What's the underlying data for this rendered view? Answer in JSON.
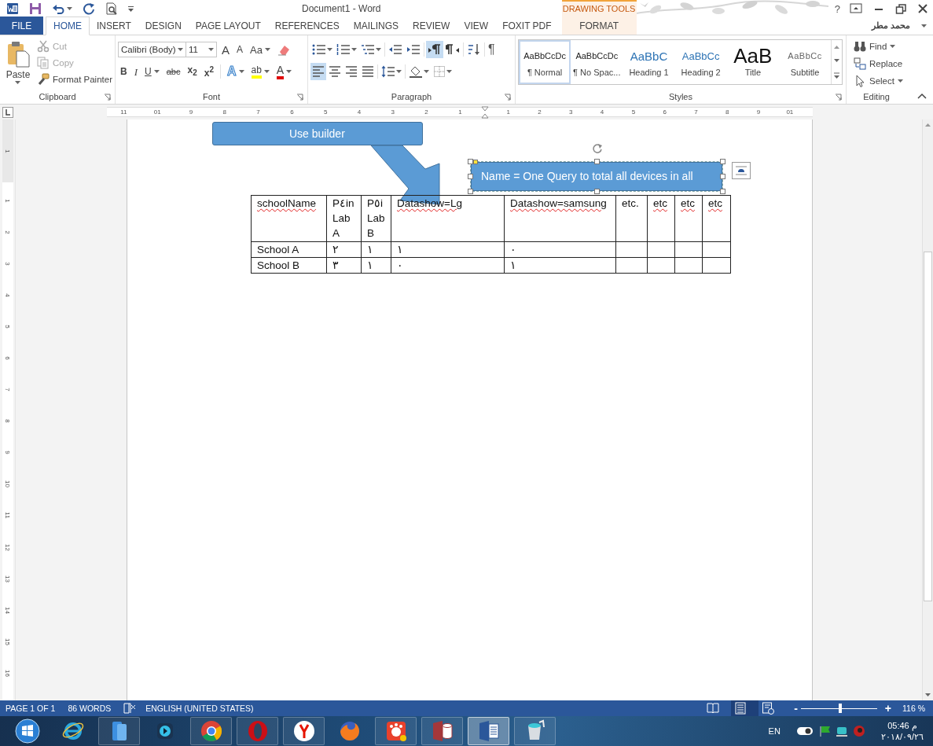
{
  "title_bar": {
    "title": "Document1 - Word",
    "help": "?"
  },
  "tabs": [
    {
      "label": "FILE",
      "kind": "file",
      "selected": false
    },
    {
      "label": "HOME",
      "kind": "normal",
      "selected": true
    },
    {
      "label": "INSERT",
      "kind": "normal",
      "selected": false
    },
    {
      "label": "DESIGN",
      "kind": "normal",
      "selected": false
    },
    {
      "label": "PAGE LAYOUT",
      "kind": "normal",
      "selected": false
    },
    {
      "label": "REFERENCES",
      "kind": "normal",
      "selected": false
    },
    {
      "label": "MAILINGS",
      "kind": "normal",
      "selected": false
    },
    {
      "label": "REVIEW",
      "kind": "normal",
      "selected": false
    },
    {
      "label": "VIEW",
      "kind": "normal",
      "selected": false
    },
    {
      "label": "FOXIT PDF",
      "kind": "normal",
      "selected": false
    },
    {
      "label": "FORMAT",
      "kind": "contextual",
      "header": "DRAWING TOOLS",
      "selected": false
    }
  ],
  "account": {
    "name": "محمد مطر"
  },
  "clipboard": {
    "label": "Clipboard",
    "paste": "Paste",
    "items": [
      {
        "label": "Cut",
        "kind": "cut",
        "disabled": true
      },
      {
        "label": "Copy",
        "kind": "copy",
        "disabled": true
      },
      {
        "label": "Format Painter",
        "kind": "painter",
        "disabled": false
      }
    ]
  },
  "font": {
    "label": "Font",
    "font_name": "Calibri (Body)",
    "font_size": "11",
    "row1": [
      {
        "text": "A",
        "kind": "grow"
      },
      {
        "text": "A",
        "kind": "shrink"
      },
      {
        "text": "Aa",
        "kind": "case"
      },
      {
        "kind": "clear"
      }
    ],
    "row2": [
      {
        "text": "B",
        "kind": "bold"
      },
      {
        "text": "I",
        "kind": "italic"
      },
      {
        "text": "U",
        "kind": "underline"
      },
      {
        "text": "abc",
        "kind": "strike"
      },
      {
        "text": "x$_{2}$",
        "kind": "sub"
      },
      {
        "text": "x$^{2}$",
        "kind": "sup"
      },
      {
        "text": "A",
        "kind": "effects"
      },
      {
        "text": "ab",
        "kind": "highlight"
      },
      {
        "text": "A",
        "kind": "color"
      }
    ]
  },
  "paragraph": {
    "label": "Paragraph",
    "row1": [
      {
        "kind": "bullets",
        "selected": false
      },
      {
        "kind": "numbering",
        "selected": false
      },
      {
        "kind": "multilevel",
        "selected": false
      },
      {
        "kind": "outdent",
        "selected": false
      },
      {
        "kind": "indent",
        "selected": false
      },
      {
        "kind": "ltr",
        "selected": true
      },
      {
        "kind": "rtl",
        "selected": false
      },
      {
        "kind": "sort",
        "selected": false
      },
      {
        "kind": "pilcrow",
        "text": "¶",
        "selected": false
      }
    ],
    "row2": [
      {
        "kind": "align_left",
        "selected": true
      },
      {
        "kind": "align_center",
        "selected": false
      },
      {
        "kind": "align_right",
        "selected": false
      },
      {
        "kind": "justify",
        "selected": false
      },
      {
        "kind": "spacing",
        "selected": false
      },
      {
        "kind": "shading",
        "selected": false
      },
      {
        "kind": "borders",
        "selected": false
      }
    ]
  },
  "styles": {
    "label": "Styles",
    "items": [
      {
        "sample": "AaBbCcDc",
        "label": "¶ Normal",
        "kind": "normal",
        "selected": true
      },
      {
        "sample": "AaBbCcDc",
        "label": "¶ No Spac...",
        "kind": "normal",
        "selected": false
      },
      {
        "sample": "AaBbC",
        "label": "Heading 1",
        "kind": "heading1",
        "selected": false
      },
      {
        "sample": "AaBbCc",
        "label": "Heading 2",
        "kind": "heading2",
        "selected": false
      },
      {
        "sample": "AaB",
        "label": "Title",
        "kind": "title",
        "selected": false
      },
      {
        "sample": "AaBbCc",
        "label": "Subtitle",
        "kind": "subtitle",
        "selected": false
      }
    ]
  },
  "editing": {
    "label": "Editing",
    "items": [
      {
        "label": "Find",
        "kind": "find"
      },
      {
        "label": "Replace",
        "kind": "replace"
      },
      {
        "label": "Select",
        "kind": "select"
      }
    ]
  },
  "ruler": {
    "left_numbers": [
      "11",
      "01",
      "9",
      "8",
      "7",
      "6",
      "5",
      "4",
      "3",
      "2",
      "1"
    ],
    "right_numbers": [
      "1",
      "2",
      "3",
      "4",
      "5",
      "6",
      "7",
      "8",
      "9",
      "01"
    ]
  },
  "vertical_ruler": {
    "top_number": "1",
    "numbers": [
      "1",
      "2",
      "3",
      "4",
      "5",
      "6",
      "7",
      "8",
      "9",
      "10",
      "11",
      "12",
      "13",
      "14",
      "15",
      "16"
    ]
  },
  "document": {
    "callout": {
      "text": "Use builder"
    },
    "textbox": {
      "text": "Name = One Query to total all devices in all",
      "selected": true
    },
    "table": {
      "header": [
        {
          "text": "schoolName",
          "misspelled": true
        },
        {
          "text": "P٤in Lab A",
          "misspelled": false
        },
        {
          "text": "P٥i Lab B",
          "misspelled": false
        },
        {
          "text": "Datashow=Lg",
          "misspelled": true
        },
        {
          "text": "Datashow=samsung",
          "misspelled": true
        },
        {
          "text": "etc.",
          "misspelled": false
        },
        {
          "text": "etc",
          "misspelled": true
        },
        {
          "text": "etc",
          "misspelled": true
        },
        {
          "text": "etc",
          "misspelled": true
        }
      ],
      "rows": [
        {
          "cells": [
            "School A",
            "٢",
            "١",
            "١",
            "٠"
          ]
        },
        {
          "cells": [
            "School B",
            "٣",
            "١",
            "٠",
            "١"
          ]
        }
      ]
    }
  },
  "status_bar": {
    "page": "PAGE 1 OF 1",
    "words": "86 WORDS",
    "language": "ENGLISH (UNITED STATES)",
    "views": [
      {
        "kind": "read",
        "selected": false
      },
      {
        "kind": "print",
        "selected": true
      },
      {
        "kind": "web",
        "selected": false
      }
    ],
    "zoom_out": "-",
    "zoom_in": "+",
    "zoom": {
      "level": 0.52
    },
    "zoom_label": "116 %"
  },
  "taskbar": {
    "apps": [
      {
        "kind": "start",
        "running": false,
        "active": false
      },
      {
        "kind": "browser",
        "running": false,
        "active": false
      },
      {
        "kind": "files",
        "running": true,
        "active": false
      },
      {
        "kind": "media",
        "running": false,
        "active": false
      },
      {
        "kind": "chrome",
        "running": true,
        "active": false
      },
      {
        "kind": "opera",
        "running": true,
        "active": false
      },
      {
        "kind": "yandex",
        "running": true,
        "active": false
      },
      {
        "kind": "firefox",
        "running": false,
        "active": false
      },
      {
        "kind": "gom",
        "running": true,
        "active": false
      },
      {
        "kind": "access",
        "running": true,
        "active": false
      },
      {
        "kind": "word",
        "running": true,
        "active": true
      },
      {
        "kind": "bucket",
        "running": true,
        "active": false
      }
    ],
    "language": "EN",
    "time": "05:46 م",
    "date": "٢٠١٨/٠٩/٢٦"
  }
}
